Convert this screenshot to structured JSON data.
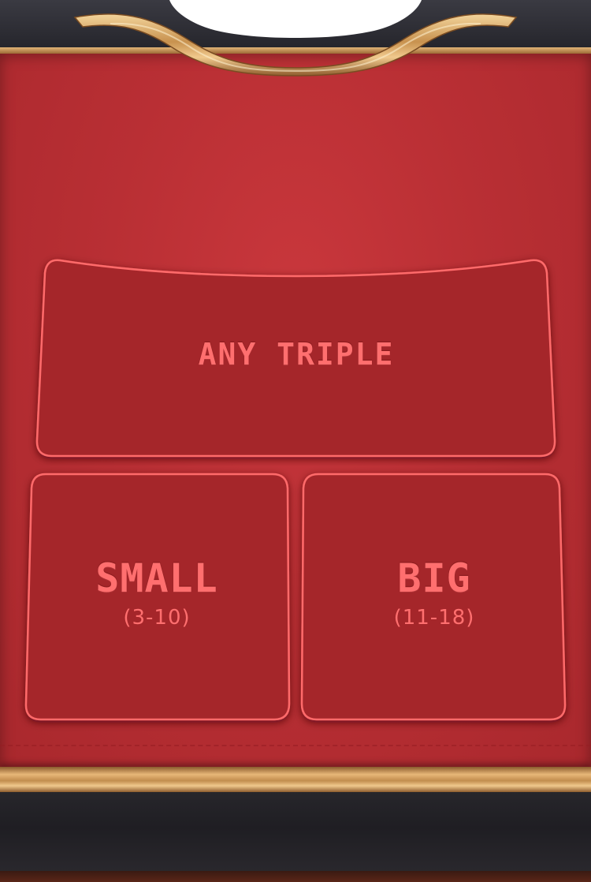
{
  "table": {
    "felt_color": "#b92f34",
    "label_color": "#ff6f6f",
    "rim_color": "#e7b778",
    "leather_color": "#2a2a30"
  },
  "zones": {
    "any_triple": {
      "label": "ANY TRIPLE"
    },
    "small": {
      "label": "SMALL",
      "range": "(3-10)"
    },
    "big": {
      "label": "BIG",
      "range": "(11-18)"
    }
  }
}
